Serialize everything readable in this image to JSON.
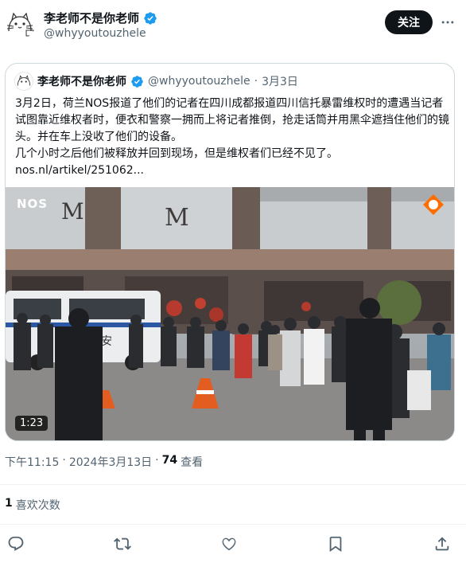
{
  "author": {
    "name": "李老师不是你老师",
    "handle": "@whyyoutouzhele",
    "follow_label": "关注"
  },
  "quoted": {
    "name": "李老师不是你老师",
    "handle": "@whyyoutouzhele",
    "date": "3月3日",
    "sep": "·",
    "text_1": "3月2日，荷兰NOS报道了他们的记者在四川成都报道四川信托暴雷维权时的遭遇当记者试图靠近维权者时，便衣和警察一拥而上将记者推倒，抢走话筒并用黑伞遮挡住他们的镜头。并在车上没收了他们的设备。",
    "text_2": "几个小时之后他们被释放并回到现场，但是维权者们已经不见了。",
    "link": "nos.nl/artikel/251062...",
    "video": {
      "duration": "1:23",
      "logo_left": "NOS",
      "sign_letter_1": "M",
      "sign_letter_2": "M",
      "van_text": "安"
    }
  },
  "meta": {
    "time": "下午11:15",
    "date": "2024年3月13日",
    "sep1": "·",
    "views_count": "74",
    "views_label": "查看"
  },
  "likes": {
    "count": "1",
    "label": "喜欢次数"
  },
  "colors": {
    "verified": "#1d9bf0",
    "text_primary": "#0f1419",
    "text_secondary": "#536471",
    "border": "#cfd9de"
  },
  "icons": [
    "verified-badge-icon",
    "more-icon",
    "reply-icon",
    "retweet-icon",
    "like-icon",
    "bookmark-icon",
    "share-icon"
  ]
}
